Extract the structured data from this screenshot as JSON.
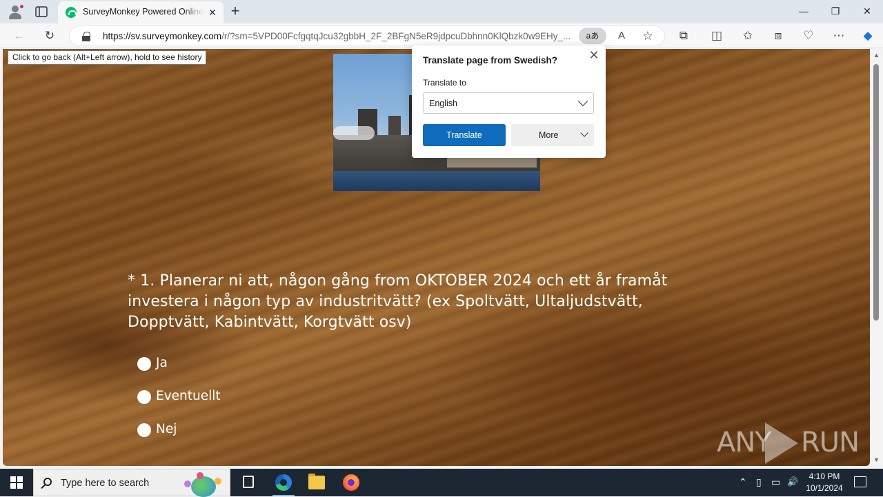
{
  "browser": {
    "tab": {
      "title": "SurveyMonkey Powered Online S"
    },
    "address": {
      "url_host": "https://sv.surveymonkey.com",
      "url_path": "/r/?sm=5VPD00FcfgqtqJcu32gbbH_2F_2BFgN5eR9jdpcuDbhnn0KlQbzk0w9EHy_...",
      "translate_indicator": "aあ"
    },
    "tooltip": "Click to go back (Alt+Left arrow), hold to see history",
    "icons": {
      "back": "←",
      "refresh": "↻",
      "read_aloud": "A",
      "favorite": "☆",
      "extensions": "⧉",
      "split": "◫",
      "favorites": "✩",
      "collections": "⧈",
      "performance": "♡",
      "more": "⋯",
      "copilot": "◆",
      "minimize": "—",
      "maximize": "❐",
      "close": "✕",
      "newtab": "+",
      "tab_close": "✕"
    }
  },
  "translate_popup": {
    "title": "Translate page from Swedish?",
    "label": "Translate to",
    "selected_language": "English",
    "translate_button": "Translate",
    "more_button": "More",
    "close": "✕"
  },
  "survey": {
    "question": "* 1. Planerar ni att, någon gång from OKTOBER 2024 och ett år framåt investera i någon typ av industritvätt? (ex Spoltvätt, Ultaljudstvätt, Dopptvätt, Kabintvätt, Korgtvätt osv)",
    "options": [
      {
        "label": "Ja"
      },
      {
        "label": "Eventuellt"
      },
      {
        "label": "Nej"
      }
    ]
  },
  "watermark": {
    "left": "ANY",
    "right": "RUN"
  },
  "taskbar": {
    "search_placeholder": "Type here to search",
    "time": "4:10 PM",
    "date": "10/1/2024",
    "tray": {
      "chevron": "⌃",
      "network": "▭",
      "volume": "🔊"
    }
  }
}
